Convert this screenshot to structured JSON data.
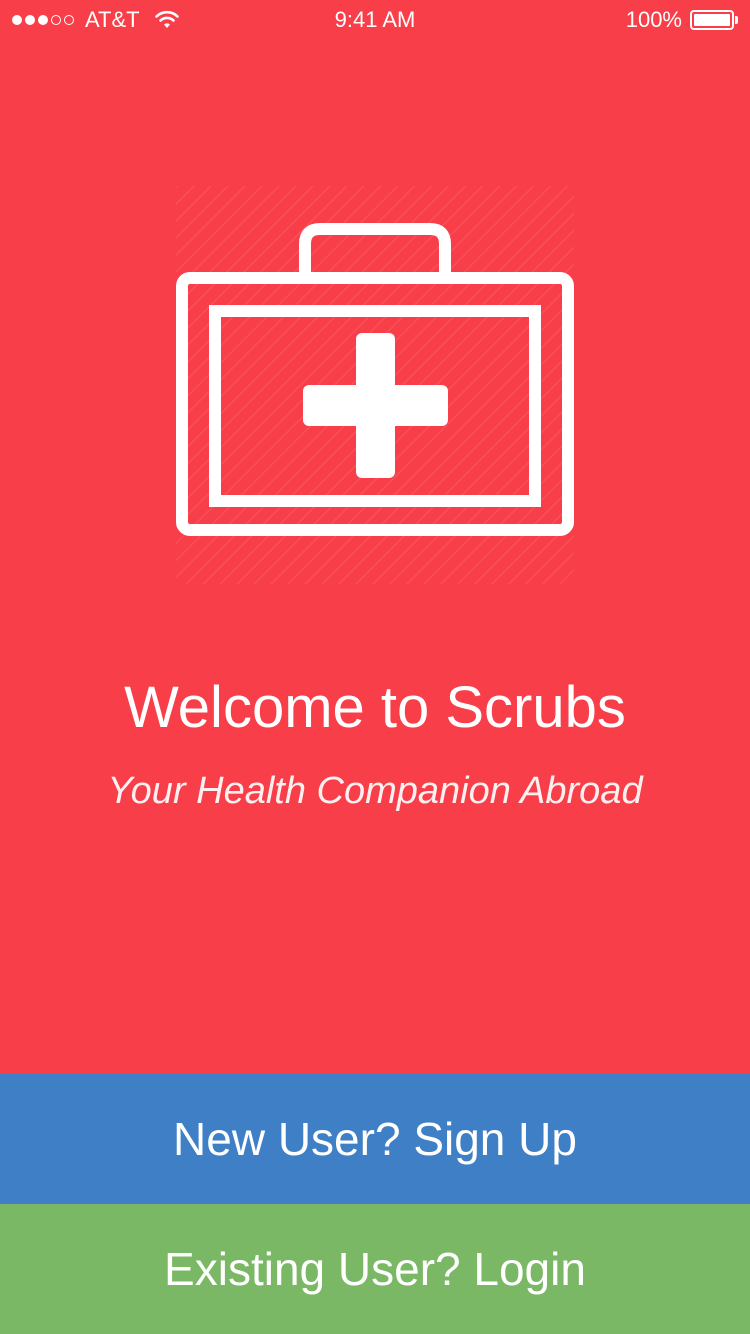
{
  "status_bar": {
    "signal_filled": 3,
    "signal_total": 5,
    "carrier": "AT&T",
    "wifi_icon": "wifi-icon",
    "time": "9:41 AM",
    "battery_percent": "100%",
    "battery_level": 1.0
  },
  "hero": {
    "icon": "first-aid-kit-icon"
  },
  "welcome": {
    "title": "Welcome to Scrubs",
    "subtitle": "Your Health Companion Abroad"
  },
  "actions": {
    "signup_label": "New User? Sign Up",
    "login_label": "Existing User? Login"
  },
  "colors": {
    "background": "#f83e48",
    "signup": "#3e7fc6",
    "login": "#7ab866",
    "text": "#ffffff"
  }
}
